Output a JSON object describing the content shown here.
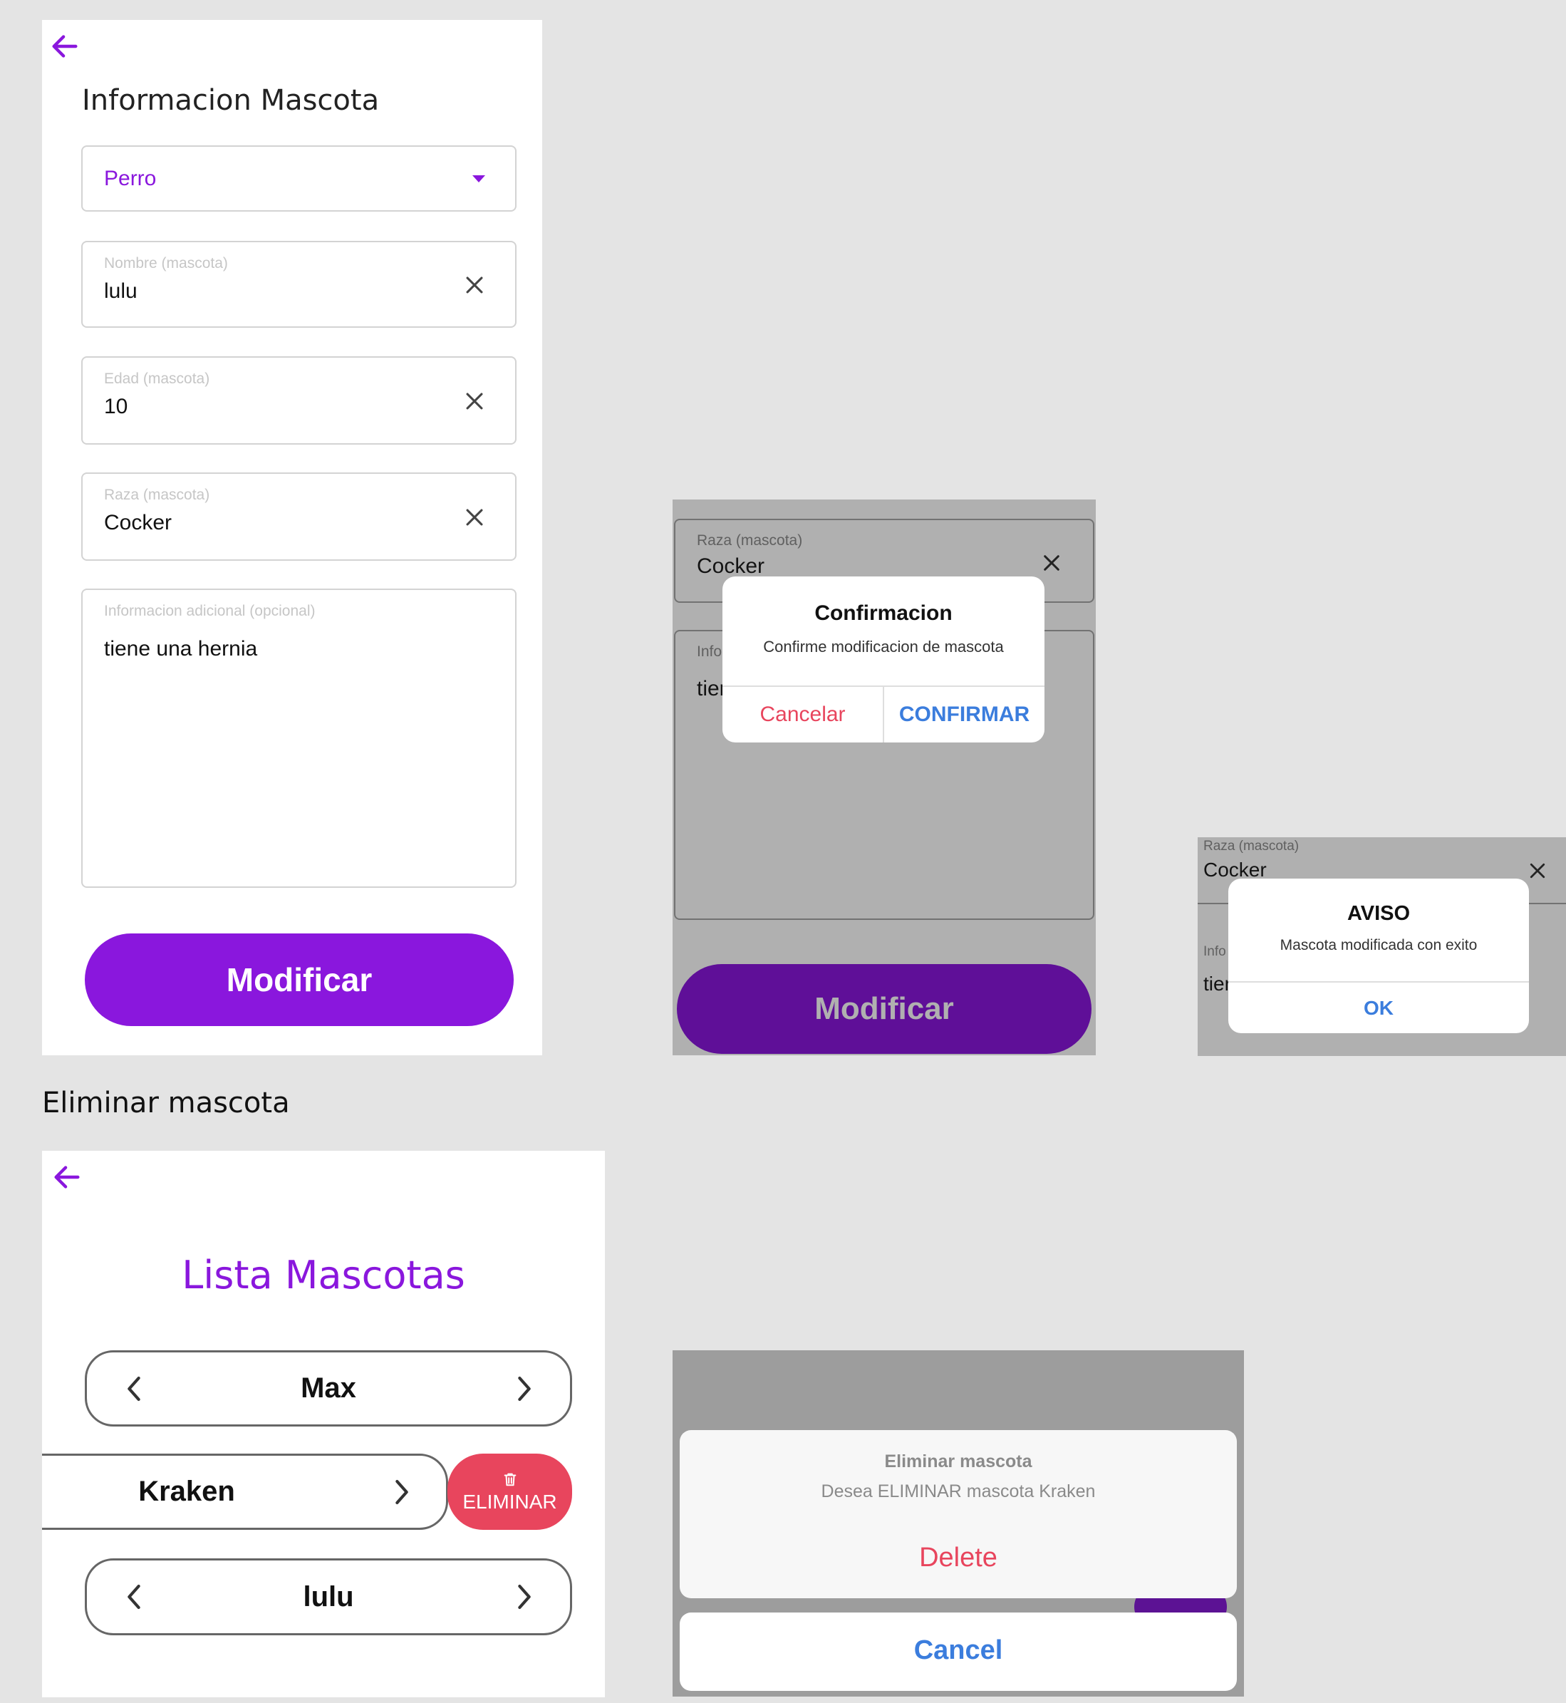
{
  "modify_form": {
    "title": "Informacion Mascota",
    "species_selected": "Perro",
    "fields": {
      "name": {
        "label": "Nombre (mascota)",
        "value": "lulu"
      },
      "age": {
        "label": "Edad (mascota)",
        "value": "10"
      },
      "breed": {
        "label": "Raza (mascota)",
        "value": "Cocker"
      },
      "info": {
        "label": "Informacion adicional (opcional)",
        "value": "tiene una hernia"
      }
    },
    "submit_label": "Modificar"
  },
  "confirm_dialog": {
    "bg_field_label": "Raza (mascota)",
    "bg_field_value": "Cocker",
    "bg_info_label": "Info",
    "bg_info_value": "tier",
    "title": "Confirmacion",
    "message": "Confirme modificacion de mascota",
    "cancel_label": "Cancelar",
    "confirm_label": "CONFIRMAR",
    "bg_button_label": "Modificar"
  },
  "success_dialog": {
    "bg_field_label": "Raza (mascota)",
    "bg_field_value": "Cocker",
    "bg_info_label": "Info",
    "bg_info_value": "tier",
    "title": "AVISO",
    "message": "Mascota modificada con exito",
    "ok_label": "OK"
  },
  "section_heading": "Eliminar mascota",
  "pet_list": {
    "title": "Lista Mascotas",
    "items": [
      {
        "name": "Max"
      },
      {
        "name": "Kraken"
      },
      {
        "name": "lulu"
      }
    ],
    "delete_label": "ELIMINAR"
  },
  "delete_sheet": {
    "title": "Eliminar mascota",
    "message": "Desea ELIMINAR mascota Kraken",
    "delete_label": "Delete",
    "cancel_label": "Cancel"
  },
  "colors": {
    "accent_purple": "#8a17dd",
    "danger_red": "#e8455d",
    "ios_blue": "#3b7ddd",
    "background": "#e4e4e4"
  },
  "icons": [
    "back-arrow-icon",
    "dropdown-caret-icon",
    "clear-icon",
    "chevron-left-icon",
    "chevron-right-icon",
    "trash-icon"
  ]
}
